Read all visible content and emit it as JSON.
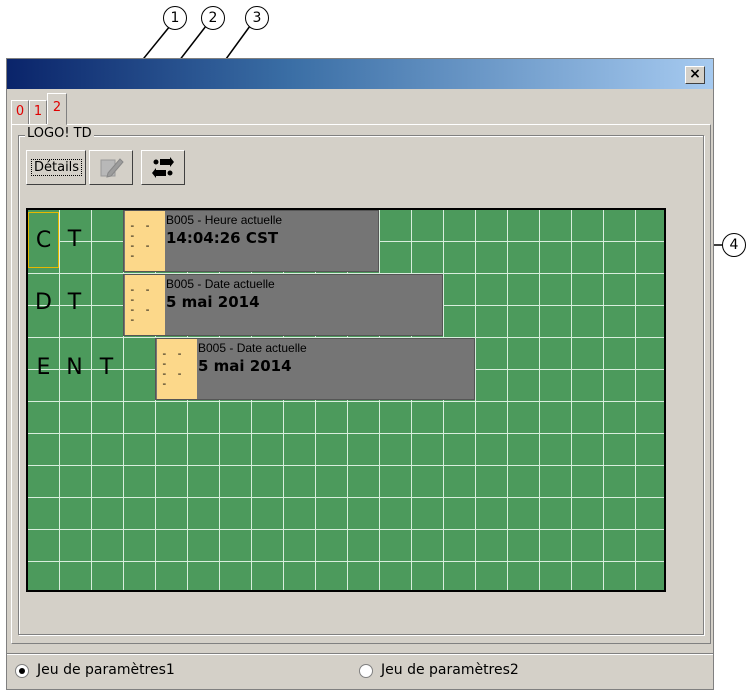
{
  "window": {
    "close_label": "×"
  },
  "tabs": [
    {
      "label": "0",
      "active": false
    },
    {
      "label": "1",
      "active": false
    },
    {
      "label": "2",
      "active": true
    }
  ],
  "group": {
    "label": "LOGO! TD"
  },
  "toolbar": {
    "details_label": "Détails",
    "edit_icon": "edit-pencil-icon",
    "connect_icon": "connection-icon"
  },
  "grid": {
    "rows": [
      {
        "letters": [
          "C",
          "T"
        ],
        "block": {
          "caption": "B005 - Heure actuelle",
          "value": "14:04:26 CST"
        }
      },
      {
        "letters": [
          "D",
          "T"
        ],
        "block": {
          "caption": "B005 - Date actuelle",
          "value": "5 mai 2014"
        }
      },
      {
        "letters": [
          "E",
          "N",
          "T"
        ],
        "block": {
          "caption": "B005 - Date actuelle",
          "value": "5 mai 2014"
        }
      }
    ],
    "colors": {
      "background": "#4c9a5c",
      "block": "#757575",
      "block_icon": "#fcd88a"
    }
  },
  "callouts": [
    "1",
    "2",
    "3",
    "4"
  ],
  "parameters": {
    "option1": {
      "label": "Jeu de paramètres1",
      "checked": true
    },
    "option2": {
      "label": "Jeu de paramètres2",
      "checked": false
    }
  }
}
